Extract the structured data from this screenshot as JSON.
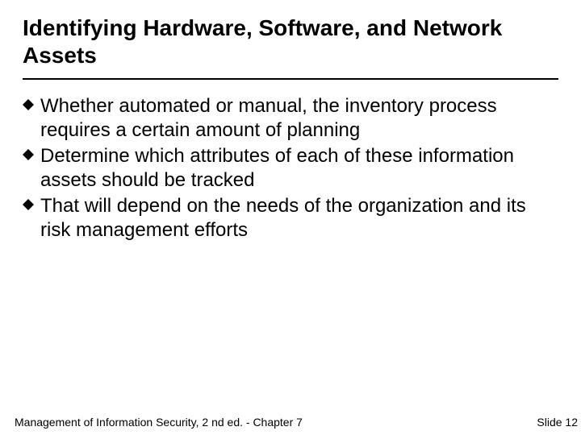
{
  "title": "Identifying Hardware, Software, and Network Assets",
  "bullets": [
    "Whether automated or manual, the inventory process requires a certain amount of planning",
    "Determine which attributes of each of these information assets should be tracked",
    "That will depend on the needs of the organization and its risk management efforts"
  ],
  "footer": {
    "left": "Management of Information Security, 2 nd ed. - Chapter 7",
    "right": "Slide 12"
  }
}
